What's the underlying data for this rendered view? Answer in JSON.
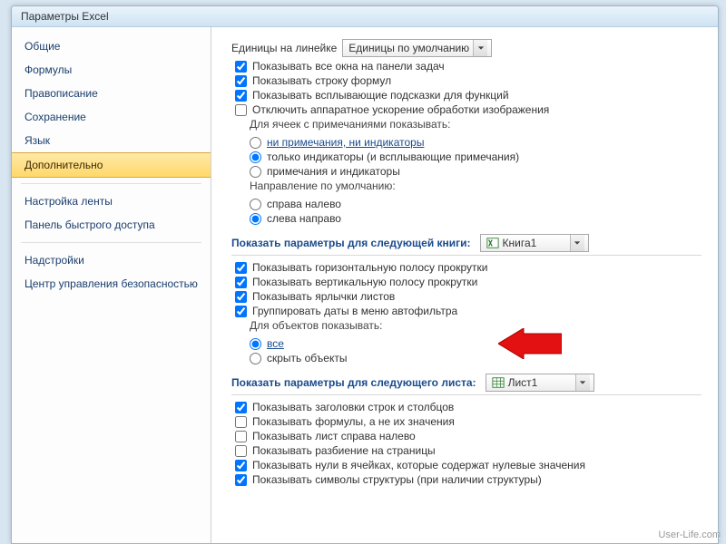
{
  "window": {
    "title": "Параметры Excel"
  },
  "sidebar": {
    "items": [
      {
        "label": "Общие"
      },
      {
        "label": "Формулы"
      },
      {
        "label": "Правописание"
      },
      {
        "label": "Сохранение"
      },
      {
        "label": "Язык"
      },
      {
        "label": "Дополнительно",
        "selected": true
      },
      {
        "label": "Настройка ленты"
      },
      {
        "label": "Панель быстрого доступа"
      },
      {
        "label": "Надстройки"
      },
      {
        "label": "Центр управления безопасностью"
      }
    ]
  },
  "ruler": {
    "label": "Единицы на линейке",
    "value": "Единицы по умолчанию"
  },
  "display_checks": [
    {
      "label": "Показывать все окна на панели задач",
      "checked": true
    },
    {
      "label": "Показывать строку формул",
      "checked": true
    },
    {
      "label": "Показывать всплывающие подсказки для функций",
      "checked": true
    },
    {
      "label": "Отключить аппаратное ускорение обработки изображения",
      "checked": false
    }
  ],
  "comments": {
    "title": "Для ячеек с примечаниями показывать:",
    "options": [
      {
        "label": "ни примечания, ни индикаторы",
        "checked": false,
        "underline": true
      },
      {
        "label": "только индикаторы (и всплывающие примечания)",
        "checked": true
      },
      {
        "label": "примечания и индикаторы",
        "checked": false
      }
    ]
  },
  "direction": {
    "title": "Направление по умолчанию:",
    "options": [
      {
        "label": "справа налево",
        "checked": false
      },
      {
        "label": "слева направо",
        "checked": true
      }
    ]
  },
  "book_section": {
    "title": "Показать параметры для следующей книги:",
    "value": "Книга1",
    "checks": [
      {
        "label": "Показывать горизонтальную полосу прокрутки",
        "checked": true
      },
      {
        "label": "Показывать вертикальную полосу прокрутки",
        "checked": true
      },
      {
        "label": "Показывать ярлычки листов",
        "checked": true
      },
      {
        "label": "Группировать даты в меню автофильтра",
        "checked": true
      }
    ],
    "objects_title": "Для объектов показывать:",
    "objects": [
      {
        "label": "все",
        "checked": true,
        "underline": true
      },
      {
        "label": "скрыть объекты",
        "checked": false
      }
    ]
  },
  "sheet_section": {
    "title": "Показать параметры для следующего листа:",
    "value": "Лист1",
    "checks": [
      {
        "label": "Показывать заголовки строк и столбцов",
        "checked": true
      },
      {
        "label": "Показывать формулы, а не их значения",
        "checked": false
      },
      {
        "label": "Показывать лист справа налево",
        "checked": false
      },
      {
        "label": "Показывать разбиение на страницы",
        "checked": false
      },
      {
        "label": "Показывать нули в ячейках, которые содержат нулевые значения",
        "checked": true
      },
      {
        "label": "Показывать символы структуры (при наличии структуры)",
        "checked": true
      }
    ]
  },
  "watermark": "User-Life.com"
}
